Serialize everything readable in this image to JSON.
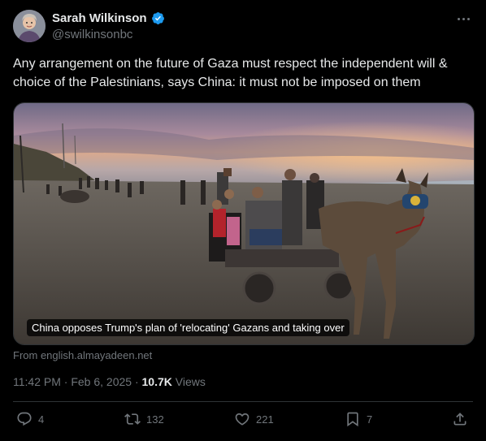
{
  "author": {
    "name": "Sarah Wilkinson",
    "handle": "@swilkinsonbc",
    "verified": true
  },
  "tweet": {
    "text": "Any arrangement on the future of Gaza must respect the independent will & choice of the Palestinians, says China: it must not be imposed on them",
    "media_caption": "China opposes Trump's plan of 'relocating' Gazans and taking over",
    "source": "From english.almayadeen.net",
    "timestamp": "11:42 PM · Feb 6, 2025 · ",
    "views_count": "10.7K",
    "views_label": " Views"
  },
  "actions": {
    "replies": "4",
    "reposts": "132",
    "likes": "221",
    "bookmarks": "7"
  },
  "icons": [
    "verified-badge-icon",
    "more-icon",
    "reply-icon",
    "repost-icon",
    "like-icon",
    "bookmark-icon",
    "share-icon"
  ],
  "colors": {
    "background": "#000000",
    "verified": "#1d9bf0",
    "secondary_text": "#71767b"
  }
}
